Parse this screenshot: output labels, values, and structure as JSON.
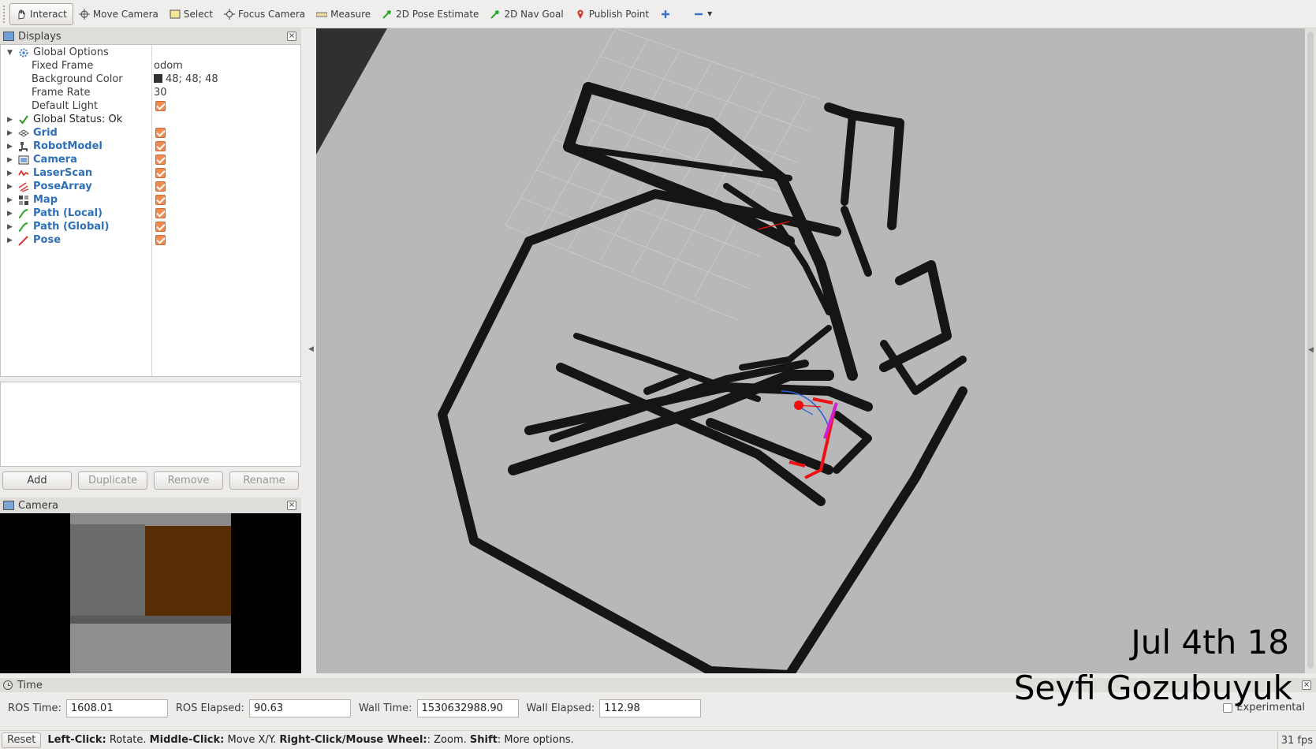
{
  "toolbar": {
    "tools": [
      {
        "label": "Interact",
        "icon": "hand-icon",
        "active": true
      },
      {
        "label": "Move Camera",
        "icon": "move-camera-icon"
      },
      {
        "label": "Select",
        "icon": "select-icon"
      },
      {
        "label": "Focus Camera",
        "icon": "focus-camera-icon"
      },
      {
        "label": "Measure",
        "icon": "ruler-icon"
      },
      {
        "label": "2D Pose Estimate",
        "icon": "green-arrow-icon"
      },
      {
        "label": "2D Nav Goal",
        "icon": "green-arrow-icon"
      },
      {
        "label": "Publish Point",
        "icon": "map-pin-icon"
      }
    ]
  },
  "displays": {
    "title": "Displays",
    "global_options": {
      "label": "Global Options",
      "props": [
        {
          "name": "Fixed Frame",
          "value": "odom"
        },
        {
          "name": "Background Color",
          "value": "48; 48; 48"
        },
        {
          "name": "Frame Rate",
          "value": "30"
        },
        {
          "name": "Default Light",
          "value": ""
        }
      ]
    },
    "global_status": "Global Status: Ok",
    "items": [
      {
        "label": "Grid",
        "icon": "grid-icon"
      },
      {
        "label": "RobotModel",
        "icon": "robot-model-icon"
      },
      {
        "label": "Camera",
        "icon": "camera-icon"
      },
      {
        "label": "LaserScan",
        "icon": "laser-scan-icon"
      },
      {
        "label": "PoseArray",
        "icon": "pose-array-icon"
      },
      {
        "label": "Map",
        "icon": "map-icon"
      },
      {
        "label": "Path (Local)",
        "icon": "path-icon"
      },
      {
        "label": "Path (Global)",
        "icon": "path-icon"
      },
      {
        "label": "Pose",
        "icon": "pose-icon"
      }
    ],
    "buttons": {
      "add": "Add",
      "duplicate": "Duplicate",
      "remove": "Remove",
      "rename": "Rename"
    }
  },
  "camera_panel": {
    "title": "Camera"
  },
  "overlay": {
    "date": "Jul 4th 18",
    "name": "Seyfi Gozubuyuk"
  },
  "time": {
    "title": "Time",
    "ros_time_label": "ROS Time:",
    "ros_time": "1608.01",
    "ros_elapsed_label": "ROS Elapsed:",
    "ros_elapsed": "90.63",
    "wall_time_label": "Wall Time:",
    "wall_time": "1530632988.90",
    "wall_elapsed_label": "Wall Elapsed:",
    "wall_elapsed": "112.98",
    "experimental": "Experimental"
  },
  "status": {
    "reset": "Reset",
    "k1": "Left-Click:",
    "t1": " Rotate. ",
    "k2": "Middle-Click:",
    "t2": " Move X/Y. ",
    "k3": "Right-Click/Mouse Wheel:",
    "t3": ": Zoom. ",
    "k4": "Shift",
    "t4": ": More options.",
    "fps": "31 fps"
  },
  "colors": {
    "accent": "#2d6fb8",
    "checkbox": "#f08c52",
    "map_bg": "#b5b5b5",
    "wall": "#1a1a1a"
  }
}
